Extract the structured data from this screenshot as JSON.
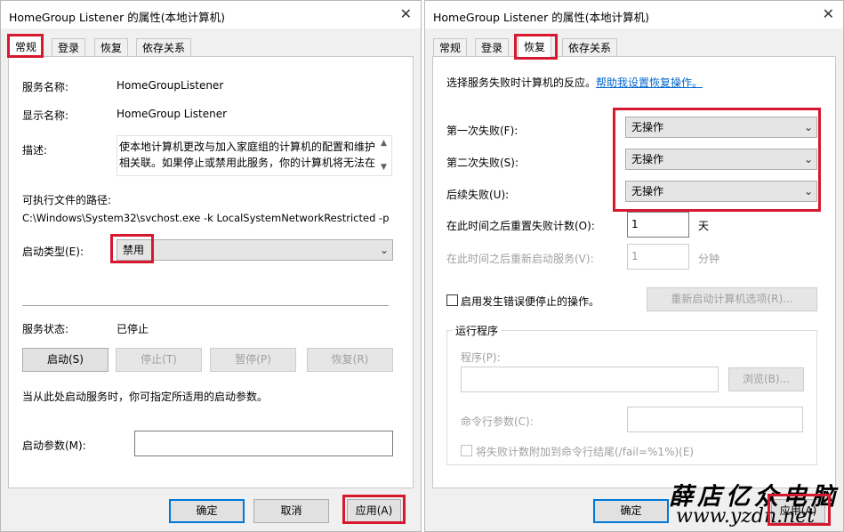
{
  "left_dialog": {
    "title": "HomeGroup Listener 的属性(本地计算机)",
    "close_glyph": "✕",
    "tabs": [
      "常规",
      "登录",
      "恢复",
      "依存关系"
    ],
    "service_name_label": "服务名称:",
    "service_name_value": "HomeGroupListener",
    "display_name_label": "显示名称:",
    "display_name_value": "HomeGroup Listener",
    "description_label": "描述:",
    "description_line1": "使本地计算机更改与加入家庭组的计算机的配置和维护",
    "description_line2": "相关联。如果停止或禁用此服务，你的计算机将无法在",
    "exe_path_label": "可执行文件的路径:",
    "exe_path_value": "C:\\Windows\\System32\\svchost.exe -k LocalSystemNetworkRestricted -p",
    "startup_type_label": "启动类型(E):",
    "startup_type_value": "禁用",
    "service_status_label": "服务状态:",
    "service_status_value": "已停止",
    "start_button": "启动(S)",
    "stop_button": "停止(T)",
    "pause_button": "暂停(P)",
    "resume_button": "恢复(R)",
    "hint_text": "当从此处启动服务时，你可指定所适用的启动参数。",
    "start_params_label": "启动参数(M):",
    "start_params_value": "",
    "ok_button": "确定",
    "cancel_button": "取消",
    "apply_button": "应用(A)"
  },
  "right_dialog": {
    "title": "HomeGroup Listener 的属性(本地计算机)",
    "close_glyph": "✕",
    "tabs": [
      "常规",
      "登录",
      "恢复",
      "依存关系"
    ],
    "intro_text": "选择服务失败时计算机的反应。",
    "help_link": "帮助我设置恢复操作。",
    "first_failure_label": "第一次失败(F):",
    "first_failure_value": "无操作",
    "second_failure_label": "第二次失败(S):",
    "second_failure_value": "无操作",
    "subsequent_failures_label": "后续失败(U):",
    "subsequent_failures_value": "无操作",
    "reset_fail_count_label": "在此时间之后重置失败计数(O):",
    "reset_fail_count_value": "1",
    "reset_fail_count_unit": "天",
    "restart_service_label": "在此时间之后重新启动服务(V):",
    "restart_service_value": "1",
    "restart_service_unit": "分钟",
    "enable_actions_label": "启用发生错误便停止的操作。",
    "restart_options_button": "重新启动计算机选项(R)...",
    "run_program_group": "运行程序",
    "program_label": "程序(P):",
    "program_value": "",
    "browse_button": "浏览(B)...",
    "cmd_params_label": "命令行参数(C):",
    "cmd_params_value": "",
    "append_fail_count_label": "将失败计数附加到命令行结尾(/fail=%1%)(E)",
    "ok_button": "确定",
    "apply_button": "应用(A)"
  },
  "watermark": {
    "chinese": "薛店亿众电脑",
    "url": "www.yzdn.net"
  },
  "colors": {
    "highlight_red": "#d7192f",
    "link_blue": "#0066cc",
    "default_button_border": "#0078d7"
  }
}
